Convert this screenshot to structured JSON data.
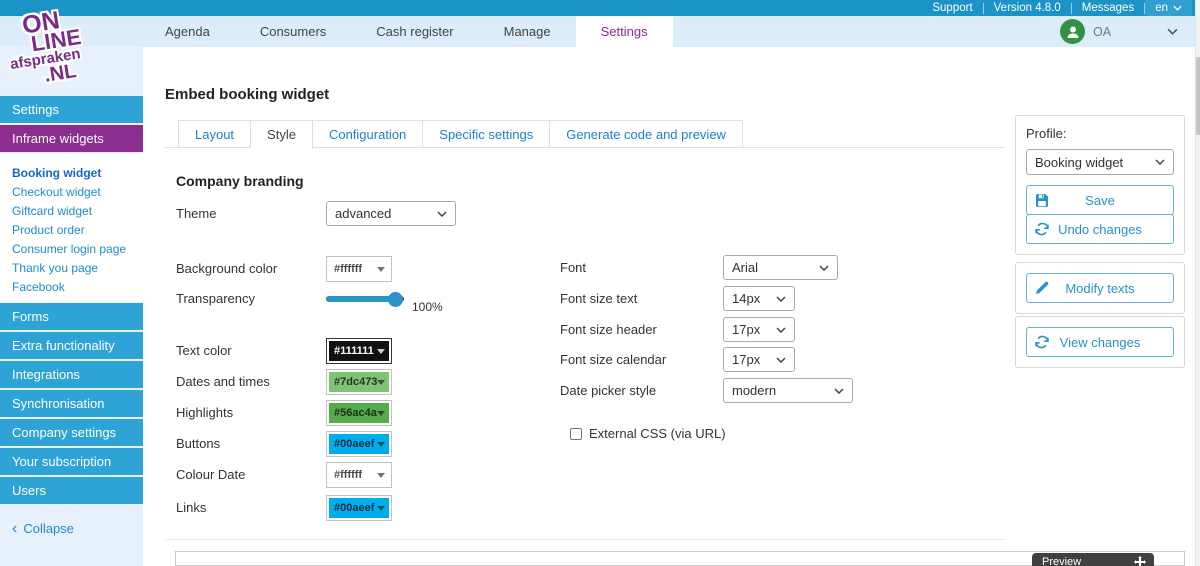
{
  "topbar": {
    "support": "Support",
    "version": "Version 4.8.0",
    "messages": "Messages",
    "language": "en"
  },
  "logo": {
    "line1": "ON",
    "line2": "LINE",
    "line3": "afspraken",
    "line4": ".NL"
  },
  "nav": {
    "items": [
      {
        "label": "Agenda"
      },
      {
        "label": "Consumers"
      },
      {
        "label": "Cash register"
      },
      {
        "label": "Manage"
      },
      {
        "label": "Settings"
      }
    ],
    "user_initials": "OA"
  },
  "sidebar": {
    "section_settings": "Settings",
    "section_iframe": "Inframe widgets",
    "sub_items": [
      "Booking widget",
      "Checkout widget",
      "Giftcard widget",
      "Product order",
      "Consumer login page",
      "Thank you page",
      "Facebook"
    ],
    "sections": [
      "Forms",
      "Extra functionality",
      "Integrations",
      "Synchronisation",
      "Company settings",
      "Your subscription",
      "Users"
    ],
    "collapse": "Collapse"
  },
  "main": {
    "title": "Embed booking widget",
    "tabs": [
      "Layout",
      "Style",
      "Configuration",
      "Specific settings",
      "Generate code and preview"
    ],
    "section_title": "Company branding",
    "fields": {
      "theme": {
        "label": "Theme",
        "value": "advanced"
      },
      "background": {
        "label": "Background color",
        "value": "#ffffff"
      },
      "transparency": {
        "label": "Transparency",
        "value": "100%"
      },
      "text_color": {
        "label": "Text color",
        "value": "#111111"
      },
      "dates": {
        "label": "Dates and times",
        "value": "#7dc473"
      },
      "highlights": {
        "label": "Highlights",
        "value": "#56ac4a"
      },
      "buttons": {
        "label": "Buttons",
        "value": "#00aeef"
      },
      "colour_date": {
        "label": "Colour Date",
        "value": "#ffffff"
      },
      "links": {
        "label": "Links",
        "value": "#00aeef"
      },
      "font": {
        "label": "Font",
        "value": "Arial"
      },
      "font_size_text": {
        "label": "Font size text",
        "value": "14px"
      },
      "font_size_header": {
        "label": "Font size header",
        "value": "17px"
      },
      "font_size_calendar": {
        "label": "Font size calendar",
        "value": "17px"
      },
      "date_picker": {
        "label": "Date picker style",
        "value": "modern"
      },
      "external_css": {
        "label": "External CSS (via URL)",
        "checked": false
      }
    }
  },
  "panel": {
    "profile_label": "Profile:",
    "profile_value": "Booking widget",
    "save": "Save",
    "undo": "Undo changes",
    "modify": "Modify texts",
    "view": "View changes"
  },
  "preview": {
    "label": "Preview"
  },
  "colors": {
    "accent_blue": "#00aeef",
    "brand_purple": "#8c2e90",
    "bar_blue": "#1b93c6",
    "sidebar_blue": "#2ea3d6"
  }
}
